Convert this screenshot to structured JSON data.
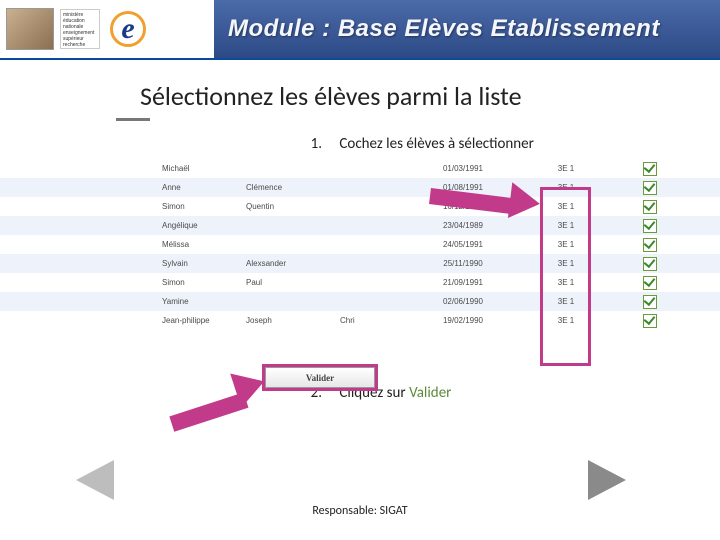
{
  "header": {
    "ministry_text": "ministère éducation nationale enseignement supérieur recherche",
    "module_title": "Module : Base Elèves Etablissement"
  },
  "title": "Sélectionnez les élèves parmi la liste",
  "instructions": [
    {
      "num": "1.",
      "text": "Cochez les élèves à sélectionner"
    },
    {
      "num": "2.",
      "text": "Cliquez sur ",
      "suffix": "Valider"
    }
  ],
  "button_label": "Valider",
  "footer": "Responsable: SIGAT",
  "columns": [
    "nom",
    "prenom1",
    "prenom2",
    "prenom3",
    "date",
    "classe",
    "check"
  ],
  "rows": [
    {
      "nom": "",
      "prenom1": "Michaël",
      "prenom2": "",
      "prenom3": "",
      "date": "01/03/1991",
      "classe": "3E 1",
      "checked": true
    },
    {
      "nom": "",
      "prenom1": "Anne",
      "prenom2": "Clémence",
      "prenom3": "",
      "date": "01/08/1991",
      "classe": "3E 1",
      "checked": true
    },
    {
      "nom": "",
      "prenom1": "Simon",
      "prenom2": "Quentin",
      "prenom3": "",
      "date": "16/12/1990",
      "classe": "3E 1",
      "checked": true
    },
    {
      "nom": "",
      "prenom1": "Angélique",
      "prenom2": "",
      "prenom3": "",
      "date": "23/04/1989",
      "classe": "3E 1",
      "checked": true
    },
    {
      "nom": "",
      "prenom1": "Mélissa",
      "prenom2": "",
      "prenom3": "",
      "date": "24/05/1991",
      "classe": "3E 1",
      "checked": true
    },
    {
      "nom": "",
      "prenom1": "Sylvain",
      "prenom2": "Alexsander",
      "prenom3": "",
      "date": "25/11/1990",
      "classe": "3E 1",
      "checked": true
    },
    {
      "nom": "",
      "prenom1": "Simon",
      "prenom2": "Paul",
      "prenom3": "",
      "date": "21/09/1991",
      "classe": "3E 1",
      "checked": true
    },
    {
      "nom": "",
      "prenom1": "Yamine",
      "prenom2": "",
      "prenom3": "",
      "date": "02/06/1990",
      "classe": "3E 1",
      "checked": true
    },
    {
      "nom": "",
      "prenom1": "Jean-philippe",
      "prenom2": "Joseph",
      "prenom3": "Chri",
      "date": "19/02/1990",
      "classe": "3E 1",
      "checked": true
    }
  ]
}
